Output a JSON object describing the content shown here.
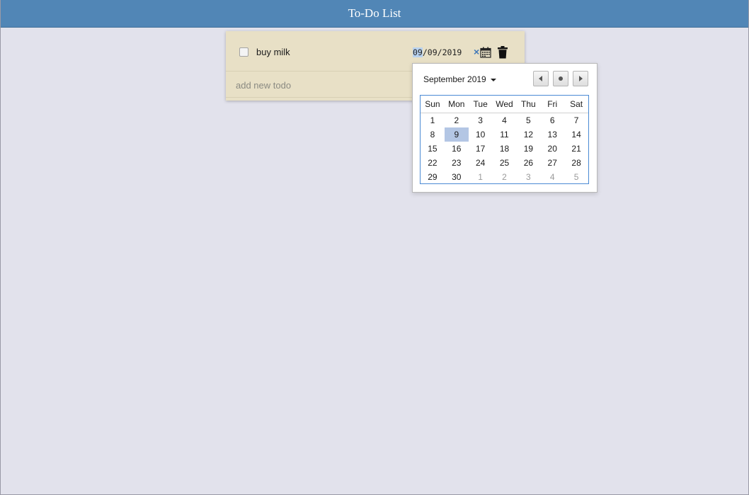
{
  "header": {
    "title": "To-Do List"
  },
  "todos": [
    {
      "text": "buy milk",
      "checked": false,
      "date": {
        "month": "09",
        "day": "09",
        "year": "2019",
        "sep": "/"
      },
      "clear_symbol": "×"
    }
  ],
  "new_todo": {
    "placeholder": "add new todo",
    "value": ""
  },
  "datepicker": {
    "month_label": "September 2019",
    "weekdays": [
      "Sun",
      "Mon",
      "Tue",
      "Wed",
      "Thu",
      "Fri",
      "Sat"
    ],
    "weeks": [
      [
        "1",
        "2",
        "3",
        "4",
        "5",
        "6",
        "7"
      ],
      [
        "8",
        "9",
        "10",
        "11",
        "12",
        "13",
        "14"
      ],
      [
        "15",
        "16",
        "17",
        "18",
        "19",
        "20",
        "21"
      ],
      [
        "22",
        "23",
        "24",
        "25",
        "26",
        "27",
        "28"
      ],
      [
        "29",
        "30",
        "1",
        "2",
        "3",
        "4",
        "5"
      ]
    ],
    "selected_day": "9",
    "prev_icon": "triangle-left-icon",
    "today_icon": "dot-icon",
    "next_icon": "triangle-right-icon"
  },
  "colors": {
    "header_bg": "#5186b6",
    "page_bg": "#e2e2ec",
    "card_bg": "#e8e0c6",
    "selected_day_bg": "#b3c6e4",
    "accent": "#4a8ad4"
  }
}
